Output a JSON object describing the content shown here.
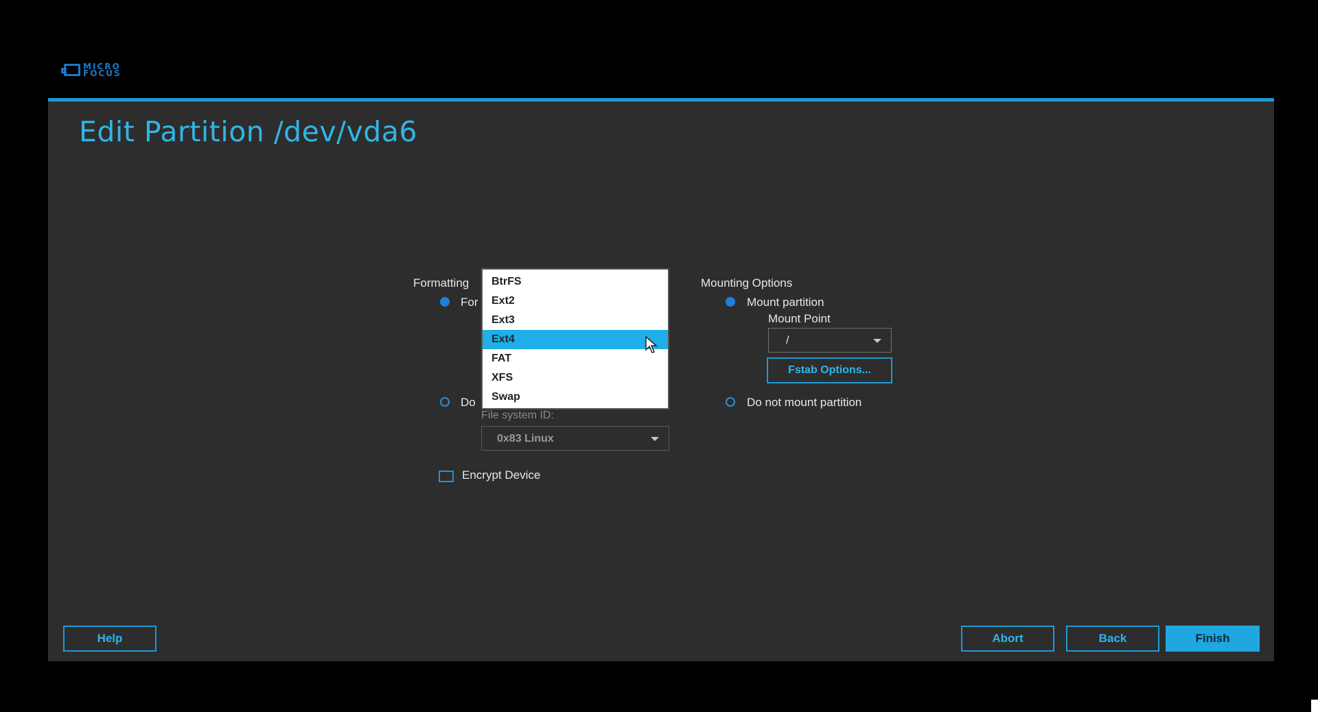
{
  "logo": {
    "line1": "MICRO",
    "line2": "FOCUS"
  },
  "title": "Edit Partition /dev/vda6",
  "formatting": {
    "label": "Formatting",
    "format_radio_label": "For",
    "noformat_radio_label": "Do",
    "fs_id_label": "File system ID:",
    "fs_id_value": "0x83 Linux",
    "encrypt_label": "Encrypt Device"
  },
  "mounting": {
    "label": "Mounting Options",
    "mount_radio_label": "Mount partition",
    "mount_point_label": "Mount Point",
    "mount_point_value": "/",
    "fstab_button": "Fstab Options...",
    "nomount_radio_label": "Do not mount partition"
  },
  "filesystem_dropdown": {
    "options": [
      "BtrFS",
      "Ext2",
      "Ext3",
      "Ext4",
      "FAT",
      "XFS",
      "Swap"
    ],
    "selected": "Ext4"
  },
  "footer": {
    "help": "Help",
    "abort": "Abort",
    "back": "Back",
    "finish": "Finish"
  },
  "colors": {
    "accent": "#1e9ad6",
    "title": "#31b5e6",
    "panel": "#2d2d2d",
    "selected": "#1faee8"
  }
}
